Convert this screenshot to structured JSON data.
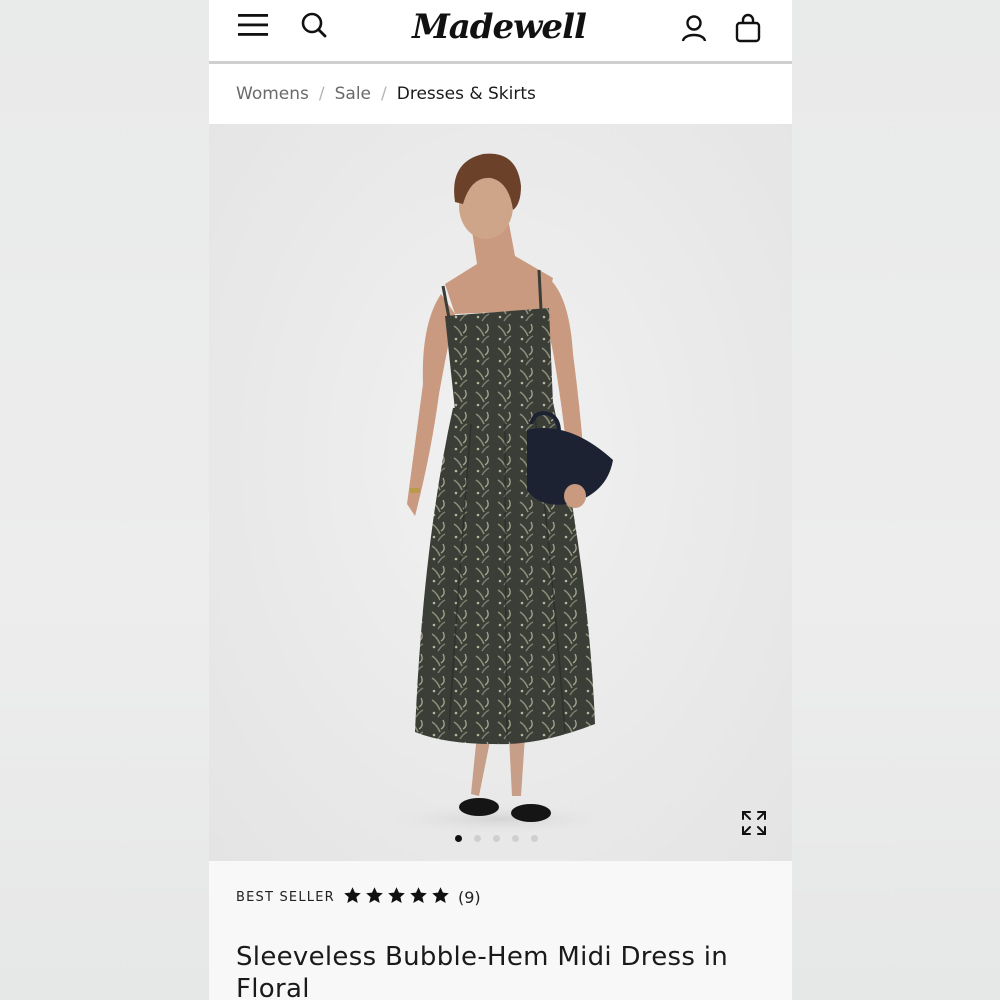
{
  "brand": {
    "logo_text": "Madewell"
  },
  "header": {
    "icons": [
      "menu-icon",
      "search-icon",
      "account-icon",
      "bag-icon"
    ]
  },
  "breadcrumb": {
    "items": [
      "Womens",
      "Sale",
      "Dresses & Skirts"
    ],
    "separator": "/"
  },
  "gallery": {
    "image_count": 5,
    "active_index": 0,
    "expand_icon": "expand-icon"
  },
  "product": {
    "badge": "BEST SELLER",
    "rating_stars": 5,
    "review_count": "(9)",
    "title": "Sleeveless Bubble-Hem Midi Dress in Floral"
  },
  "colors": {
    "accent": "#111111",
    "dress": "#3b3f38",
    "bag": "#1d2233"
  }
}
